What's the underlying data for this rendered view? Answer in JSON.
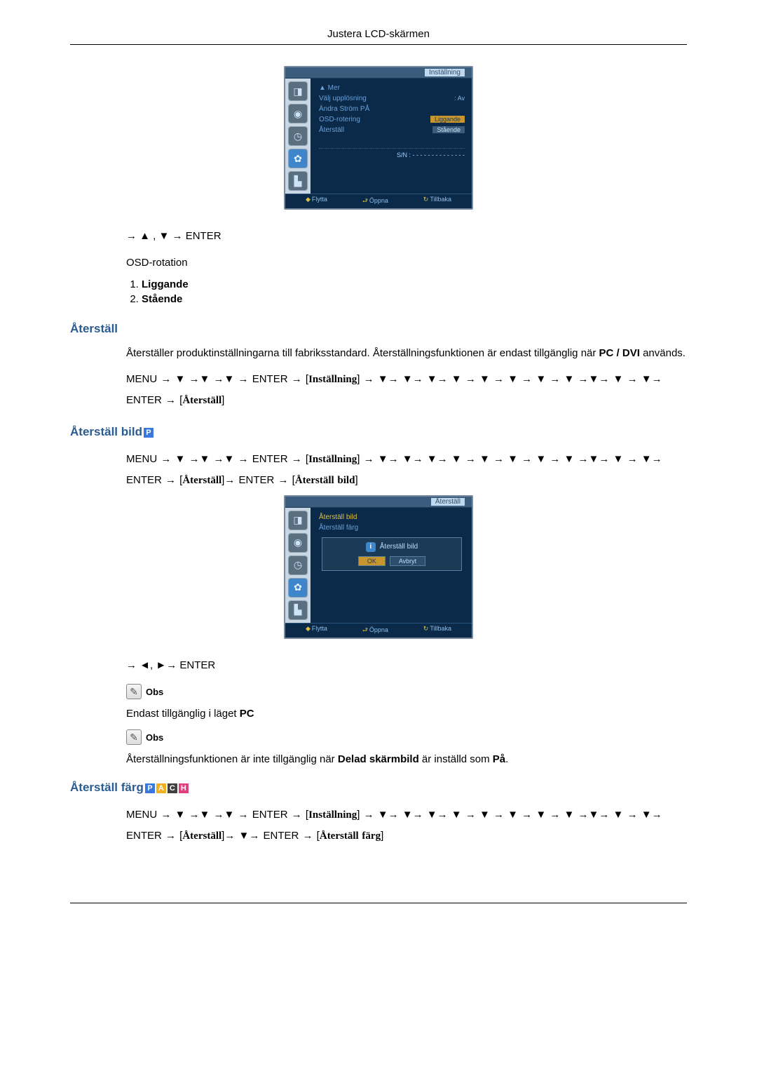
{
  "header": {
    "title": "Justera LCD-skärmen"
  },
  "figure1": {
    "title": "Inställning",
    "lines": {
      "mer": "▲ Mer",
      "valj": "Välj upplösning",
      "andra": "Ändra Ström PÅ",
      "osd": "OSD-rotering",
      "aterstall": "Återställ"
    },
    "vals": {
      "av": ": Av",
      "ligg": "Liggande",
      "sta": "Stående"
    },
    "sn": "S/N : - - - - - - - - - - - - - -",
    "footer": {
      "flytta": "Flytta",
      "oppna": "Öppna",
      "tillbaka": "Tillbaka"
    }
  },
  "nav1": {
    "line": "→ ▲ , ▼ → ENTER"
  },
  "osd_rotation_label": "OSD-rotation",
  "options": {
    "opt1": "Liggande",
    "opt2": "Stående"
  },
  "sec_aterstall": {
    "heading": "Återställ",
    "para1a": "Återställer produktinställningarna till fabriksstandard. Återställningsfunktionen är endast tillgänglig när ",
    "pcdvi": "PC / DVI",
    "para1b": " används.",
    "path1": "MENU → ▼ →▼ →▼ → ENTER → [",
    "term1": "Inställning",
    "mid": "] → ▼→ ▼→ ▼→ ▼ → ▼ → ▼ → ▼ → ▼ →▼→ ▼ → ▼→ ENTER → [",
    "term2": "Återställ",
    "end": "]"
  },
  "sec_bild": {
    "heading": "Återställ bild",
    "path": "MENU → ▼ →▼ →▼ → ENTER → [",
    "term1": "Inställning",
    "mid1": "] → ▼→ ▼→ ▼→ ▼ → ▼ → ▼ → ▼ → ▼ →▼→ ▼ → ▼→ ENTER → [",
    "term2": "Återställ",
    "mid2": "]→ ENTER → [",
    "term3": "Återställ bild",
    "end": "]"
  },
  "figure2": {
    "title": "Återställ",
    "opt_bild": "Återställ bild",
    "opt_farg": "Återställ färg",
    "dlg_title": "Återställ bild",
    "ok": "OK",
    "cancel": "Avbryt",
    "footer": {
      "flytta": "Flytta",
      "oppna": "Öppna",
      "tillbaka": "Tillbaka"
    }
  },
  "nav2": {
    "line": "→ ◄, ►→ ENTER"
  },
  "obs": "Obs",
  "obs1_text_a": "Endast tillgänglig i läget ",
  "obs1_text_b": "PC",
  "obs2_text_a": "Återställningsfunktionen är inte tillgänglig när ",
  "obs2_text_bold": "Delad skärmbild",
  "obs2_text_b": " är inställd som ",
  "obs2_text_bold2": "På",
  "obs2_text_c": ".",
  "sec_farg": {
    "heading": "Återställ färg",
    "path": "MENU → ▼ →▼ →▼ → ENTER → [",
    "term1": "Inställning",
    "mid1": "] → ▼→ ▼→ ▼→ ▼ → ▼ → ▼ → ▼ → ▼ →▼→ ▼ → ▼→ ENTER → [",
    "term2": "Återställ",
    "mid2": "]→ ▼→ ENTER → [",
    "term3": "Återställ färg",
    "end": "]"
  },
  "badges": {
    "P": "P",
    "A": "A",
    "C": "C",
    "H": "H"
  }
}
